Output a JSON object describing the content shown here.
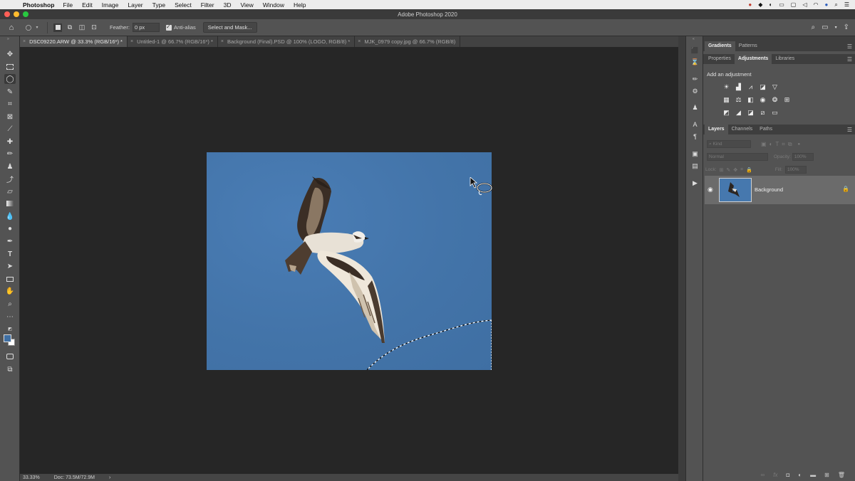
{
  "menubar": {
    "app_name": "Photoshop",
    "items": [
      "File",
      "Edit",
      "Image",
      "Layer",
      "Type",
      "Select",
      "Filter",
      "3D",
      "View",
      "Window",
      "Help"
    ]
  },
  "window": {
    "title": "Adobe Photoshop 2020"
  },
  "options": {
    "feather_label": "Feather:",
    "feather_value": "0 px",
    "antialias_label": "Anti-alias",
    "antialias_checked": true,
    "select_mask_label": "Select and Mask..."
  },
  "tabs": [
    {
      "label": "DSC09220.ARW @ 33.3% (RGB/16*) *",
      "active": true
    },
    {
      "label": "Untitled-1 @ 66.7% (RGB/16*) *",
      "active": false
    },
    {
      "label": "Background (Final).PSD @ 100% (LOGO, RGB/8) *",
      "active": false
    },
    {
      "label": "MJK_0979 copy.jpg @ 66.7% (RGB/8)",
      "active": false
    }
  ],
  "status": {
    "zoom": "33.33%",
    "doc": "Doc: 73.5M/72.9M",
    "arrow": "›"
  },
  "panel_top": {
    "tabs": [
      "Gradients",
      "Patterns"
    ],
    "active": "Gradients"
  },
  "panel_mid": {
    "tabs": [
      "Properties",
      "Adjustments",
      "Libraries"
    ],
    "active": "Adjustments",
    "add_adjustment": "Add an adjustment"
  },
  "panel_layers": {
    "tabs": [
      "Layers",
      "Channels",
      "Paths"
    ],
    "active": "Layers",
    "kind_label": "Kind",
    "blend_mode": "Normal",
    "opacity_label": "Opacity:",
    "opacity_value": "100%",
    "lock_label": "Lock:",
    "fill_label": "Fill:",
    "fill_value": "100%",
    "layer_name": "Background"
  },
  "colors": {
    "foreground": "#3f6fa3",
    "background": "#ffffff",
    "sky": "#4374a9"
  }
}
